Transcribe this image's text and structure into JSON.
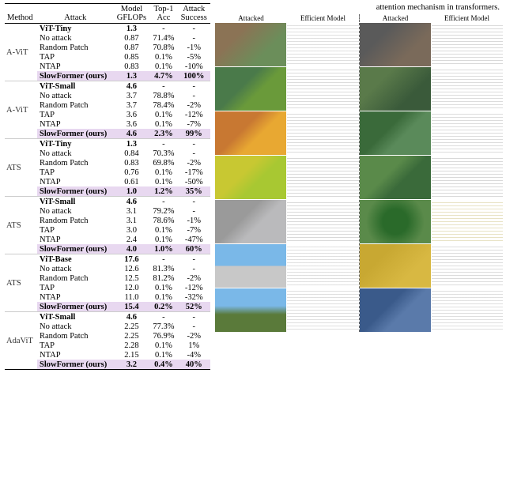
{
  "table": {
    "columns": [
      "Method",
      "Attack",
      "Model GFLOPs",
      "Top-1 Acc",
      "Attack Success"
    ],
    "sections": [
      {
        "method": "A-ViT",
        "model_header": "ViT-Tiny",
        "model_gflops": "1.3",
        "rows": [
          {
            "attack": "No attack",
            "gflops": "0.87",
            "top1": "71.4%",
            "success": "-"
          },
          {
            "attack": "Random Patch",
            "gflops": "0.87",
            "top1": "70.8%",
            "success": "-1%"
          },
          {
            "attack": "TAP",
            "gflops": "0.85",
            "top1": "0.1%",
            "success": "-5%"
          },
          {
            "attack": "NTAP",
            "gflops": "0.83",
            "top1": "0.1%",
            "success": "-10%"
          },
          {
            "attack": "SlowFormer (ours)",
            "gflops": "1.3",
            "top1": "4.7%",
            "success": "100%",
            "highlight": true
          }
        ]
      },
      {
        "method": "A-ViT",
        "model_header": "ViT-Small",
        "model_gflops": "4.6",
        "rows": [
          {
            "attack": "No attack",
            "gflops": "3.7",
            "top1": "78.8%",
            "success": "-"
          },
          {
            "attack": "Random Patch",
            "gflops": "3.7",
            "top1": "78.4%",
            "success": "-2%"
          },
          {
            "attack": "TAP",
            "gflops": "3.6",
            "top1": "0.1%",
            "success": "-12%"
          },
          {
            "attack": "NTAP",
            "gflops": "3.6",
            "top1": "0.1%",
            "success": "-7%"
          },
          {
            "attack": "SlowFormer (ours)",
            "gflops": "4.6",
            "top1": "2.3%",
            "success": "99%",
            "highlight": true
          }
        ]
      },
      {
        "method": "ATS",
        "model_header": "ViT-Tiny",
        "model_gflops": "1.3",
        "rows": [
          {
            "attack": "No attack",
            "gflops": "0.84",
            "top1": "70.3%",
            "success": "-"
          },
          {
            "attack": "Random Patch",
            "gflops": "0.83",
            "top1": "69.8%",
            "success": "-2%"
          },
          {
            "attack": "TAP",
            "gflops": "0.76",
            "top1": "0.1%",
            "success": "-17%"
          },
          {
            "attack": "NTAP",
            "gflops": "0.61",
            "top1": "0.1%",
            "success": "-50%"
          },
          {
            "attack": "SlowFormer (ours)",
            "gflops": "1.0",
            "top1": "1.2%",
            "success": "35%",
            "highlight": true
          }
        ]
      },
      {
        "method": "ATS",
        "model_header": "ViT-Small",
        "model_gflops": "4.6",
        "rows": [
          {
            "attack": "No attack",
            "gflops": "3.1",
            "top1": "79.2%",
            "success": "-"
          },
          {
            "attack": "Random Patch",
            "gflops": "3.1",
            "top1": "78.6%",
            "success": "-1%"
          },
          {
            "attack": "TAP",
            "gflops": "3.0",
            "top1": "0.1%",
            "success": "-7%"
          },
          {
            "attack": "NTAP",
            "gflops": "2.4",
            "top1": "0.1%",
            "success": "-47%"
          },
          {
            "attack": "SlowFormer (ours)",
            "gflops": "4.0",
            "top1": "1.0%",
            "success": "60%",
            "highlight": true
          }
        ]
      },
      {
        "method": "ATS",
        "model_header": "ViT-Base",
        "model_gflops": "17.6",
        "rows": [
          {
            "attack": "No attack",
            "gflops": "12.6",
            "top1": "81.3%",
            "success": "-"
          },
          {
            "attack": "Random Patch",
            "gflops": "12.5",
            "top1": "81.2%",
            "success": "-2%"
          },
          {
            "attack": "TAP",
            "gflops": "12.0",
            "top1": "0.1%",
            "success": "-12%"
          },
          {
            "attack": "NTAP",
            "gflops": "11.0",
            "top1": "0.1%",
            "success": "-32%"
          },
          {
            "attack": "SlowFormer (ours)",
            "gflops": "15.4",
            "top1": "0.2%",
            "success": "52%",
            "highlight": true
          }
        ]
      },
      {
        "method": "AdaViT",
        "model_header": "ViT-Small",
        "model_gflops": "4.6",
        "rows": [
          {
            "attack": "No attack",
            "gflops": "2.25",
            "top1": "77.3%",
            "success": "-"
          },
          {
            "attack": "Random Patch",
            "gflops": "2.25",
            "top1": "76.9%",
            "success": "-2%"
          },
          {
            "attack": "TAP",
            "gflops": "2.28",
            "top1": "0.1%",
            "success": "1%"
          },
          {
            "attack": "NTAP",
            "gflops": "2.15",
            "top1": "0.1%",
            "success": "-4%"
          },
          {
            "attack": "SlowFormer (ours)",
            "gflops": "3.2",
            "top1": "0.4%",
            "success": "40%",
            "highlight": true
          }
        ]
      }
    ]
  },
  "right_panel": {
    "header_text": "attention mechanism in transformers.",
    "col_headers": [
      "Attacked",
      "Efficient Model",
      "Attacked",
      "Efficient Model"
    ]
  }
}
